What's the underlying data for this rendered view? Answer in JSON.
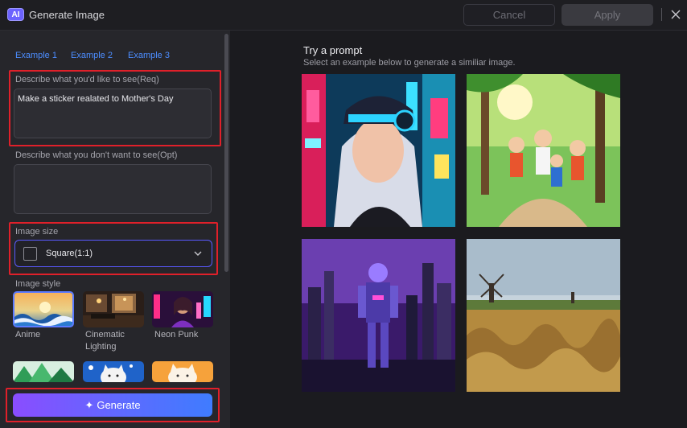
{
  "titlebar": {
    "badge": "AI",
    "title": "Generate Image",
    "cancel_label": "Cancel",
    "apply_label": "Apply"
  },
  "examples": [
    "Example 1",
    "Example 2",
    "Example 3"
  ],
  "prompt": {
    "label": "Describe what you'd like to see(Req)",
    "value": "Make a sticker realated to Mother's Day"
  },
  "negative": {
    "label": "Describe what you don't want to see(Opt)",
    "value": ""
  },
  "image_size": {
    "label": "Image size",
    "value": "Square(1:1)"
  },
  "image_style": {
    "label": "Image style",
    "styles": [
      {
        "name": "Anime",
        "line2": ""
      },
      {
        "name": "Cinematic",
        "line2": "Lighting"
      },
      {
        "name": "Neon Punk",
        "line2": ""
      }
    ]
  },
  "generate_label": "Generate",
  "prompts": {
    "title": "Try a prompt",
    "subtitle": "Select an example below to generate a similiar image."
  },
  "colors": {
    "accent": "#4c8dff",
    "highlight": "#e0202a",
    "generate_start": "#8a4dff",
    "generate_end": "#3f7cff"
  }
}
